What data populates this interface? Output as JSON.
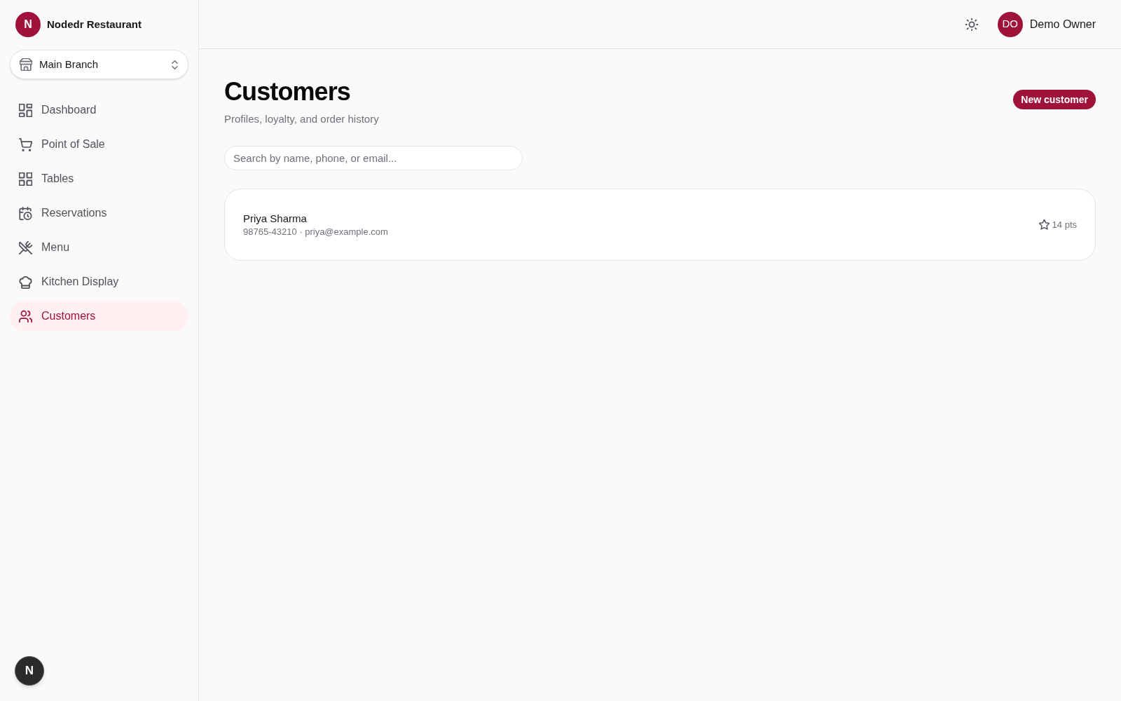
{
  "sidebar": {
    "brand": {
      "initial": "N",
      "name": "Nodedr Restaurant"
    },
    "branch_selector": {
      "value": "Main Branch"
    },
    "nav_items": [
      {
        "label": "Dashboard",
        "kind": "dashboard",
        "selected": false
      },
      {
        "label": "Point of Sale",
        "kind": "pos",
        "selected": false
      },
      {
        "label": "Tables",
        "kind": "tables",
        "selected": false
      },
      {
        "label": "Reservations",
        "kind": "reservations",
        "selected": false
      },
      {
        "label": "Menu",
        "kind": "menu",
        "selected": false
      },
      {
        "label": "Kitchen Display",
        "kind": "kitchen",
        "selected": false
      },
      {
        "label": "Customers",
        "kind": "customers",
        "selected": true
      }
    ]
  },
  "header": {
    "user": {
      "initials": "DO",
      "name": "Demo Owner"
    }
  },
  "page": {
    "title": "Customers",
    "subtitle": "Profiles, loyalty, and order history",
    "new_button": "New customer"
  },
  "search": {
    "placeholder": "Search by name, phone, or email..."
  },
  "customers": [
    {
      "name": "Priya Sharma",
      "contact": "98765-43210 · priya@example.com",
      "points": "14 pts"
    }
  ],
  "dev_indicator": {
    "label": "N"
  }
}
